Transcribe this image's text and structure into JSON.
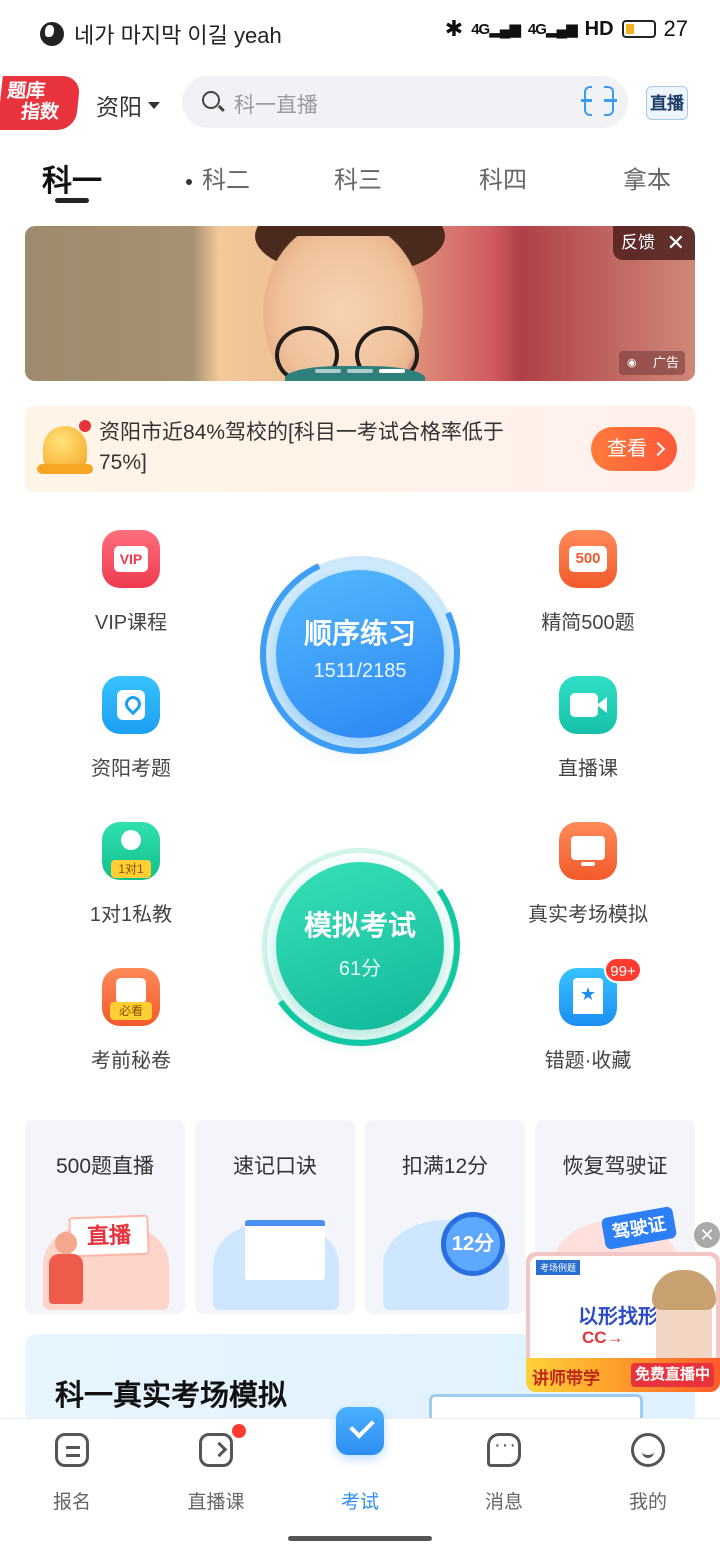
{
  "status_bar": {
    "title": "네가 마지막 이길 yeah",
    "signal1": "4G",
    "signal2": "4G",
    "hd": "HD",
    "battery": "27",
    "battery_level": 0.27
  },
  "header": {
    "logo_line1": "题库",
    "logo_line2": "指数",
    "city": "资阳",
    "search_placeholder": "科一直播",
    "live_label": "直播"
  },
  "tabs": [
    {
      "label": "科一",
      "active": true
    },
    {
      "label": "科二",
      "active": false
    },
    {
      "label": "科三",
      "active": false
    },
    {
      "label": "科四",
      "active": false
    },
    {
      "label": "拿本",
      "active": false
    }
  ],
  "banner": {
    "feedback_label": "反馈",
    "ad_label": "广告",
    "slide_count": 3,
    "active_slide": 3
  },
  "notice": {
    "text": "资阳市近84%驾校的[科目一考试合格率低于75%]",
    "button_label": "查看"
  },
  "features": {
    "left": [
      {
        "label": "VIP课程",
        "icon": "vip-icon"
      },
      {
        "label": "资阳考题",
        "icon": "location-icon"
      },
      {
        "label": "1对1私教",
        "icon": "tutor-icon"
      },
      {
        "label": "考前秘卷",
        "icon": "exam-paper-icon"
      }
    ],
    "right": [
      {
        "label": "精简500题",
        "icon": "500-icon"
      },
      {
        "label": "直播课",
        "icon": "video-icon"
      },
      {
        "label": "真实考场模拟",
        "icon": "screen-icon"
      },
      {
        "label": "错题·收藏",
        "icon": "bookmark-icon"
      }
    ],
    "badge": "99+",
    "vip_text": "VIP",
    "five_hundred_text": "500",
    "one_on_one_text": "1对1",
    "must_see_text": "必看"
  },
  "practice": {
    "title": "顺序练习",
    "progress": "1511/2185",
    "progress_fraction": 0.6915
  },
  "mock_exam": {
    "title": "模拟考试",
    "score": "61分"
  },
  "cards": [
    {
      "title": "500题直播",
      "tag": "直播"
    },
    {
      "title": "速记口诀",
      "tag": ""
    },
    {
      "title": "扣满12分",
      "tag": "12分"
    },
    {
      "title": "恢复驾驶证",
      "tag": "驾驶证"
    }
  ],
  "float_ad": {
    "header": "考场例题",
    "big_text": "以形找形",
    "cc_text": "CC→",
    "left_label": "讲师带学",
    "right_label": "免费直播中"
  },
  "section": {
    "title": "科一真实考场模拟"
  },
  "tabbar": [
    {
      "label": "报名",
      "icon": "signup-icon"
    },
    {
      "label": "直播课",
      "icon": "live-tv-icon"
    },
    {
      "label": "考试",
      "icon": "exam-icon",
      "active": true
    },
    {
      "label": "消息",
      "icon": "message-icon"
    },
    {
      "label": "我的",
      "icon": "profile-icon"
    }
  ],
  "colors": {
    "accent": "#2d8ff2",
    "practice_blue": "#2a86f2",
    "exam_green": "#10b89a",
    "alert_red": "#ff3b30",
    "orange": "#ff6a3a"
  }
}
